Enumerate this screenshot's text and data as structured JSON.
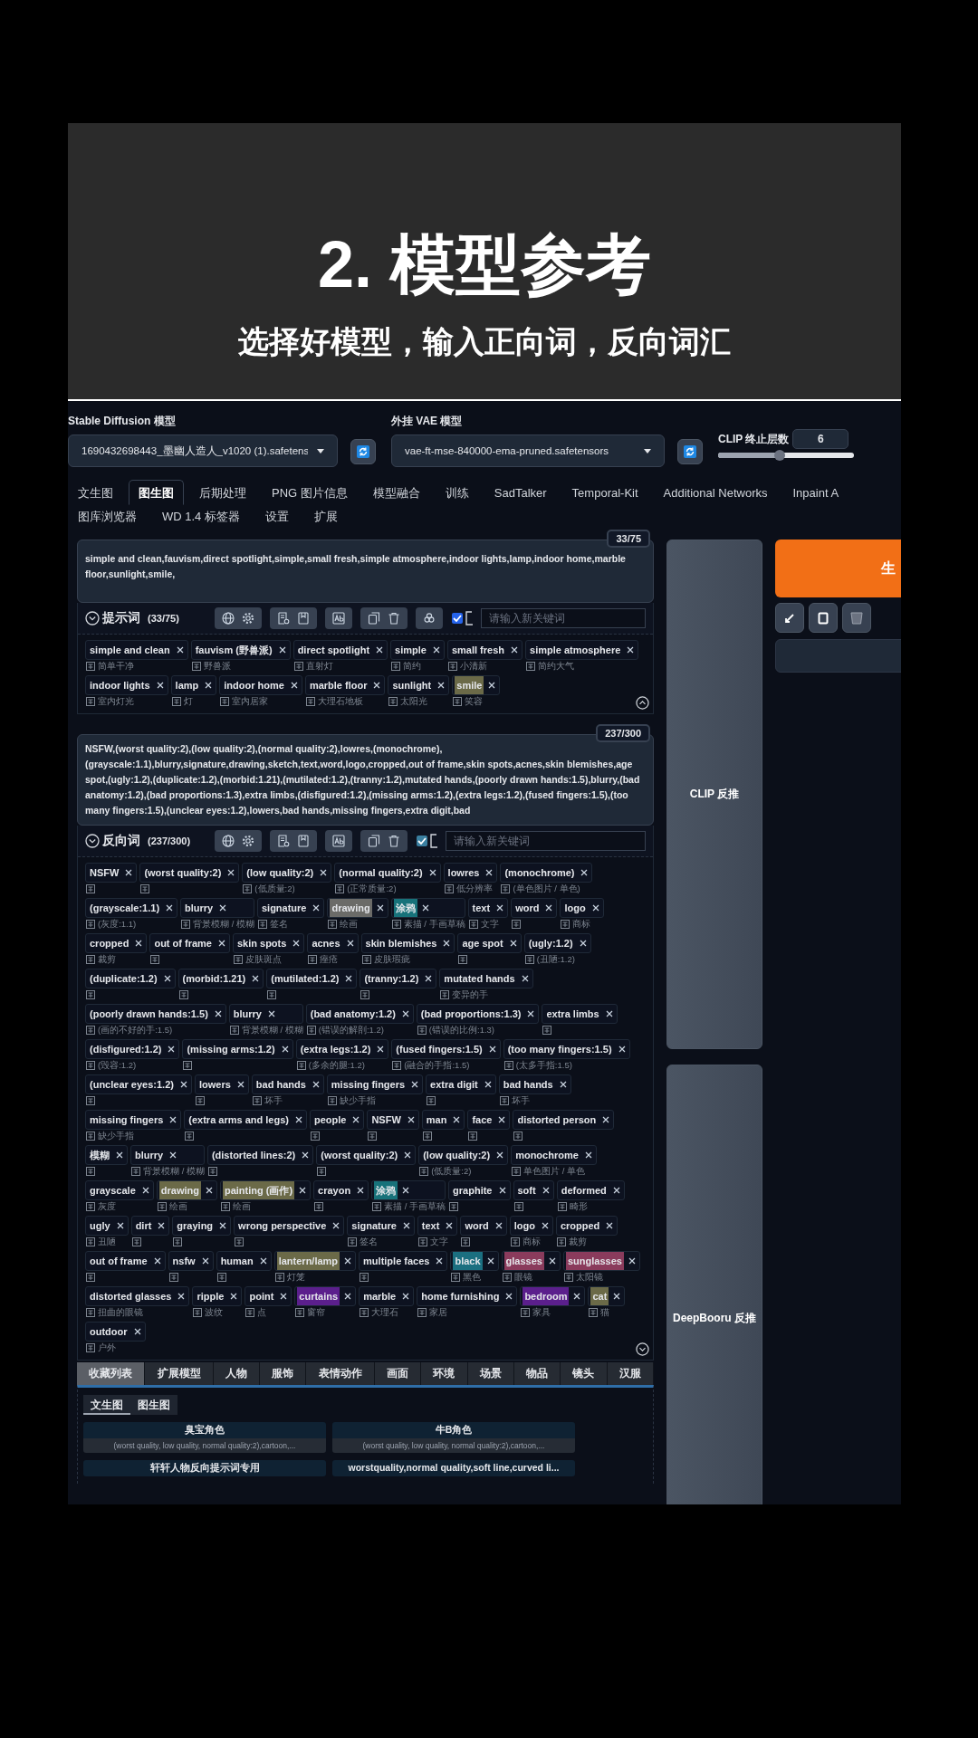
{
  "header": {
    "title": "2. 模型参考",
    "subtitle": "选择好模型，输入正向词，反向词汇"
  },
  "models": {
    "sd_label": "Stable Diffusion 模型",
    "sd_value": "1690432698443_墨幽人造人_v1020 (1).safetens",
    "vae_label": "外挂 VAE 模型",
    "vae_value": "vae-ft-mse-840000-ema-pruned.safetensors",
    "clip_label": "CLIP 终止层数",
    "clip_value": "6",
    "clip_slider": {
      "level": 0.45
    }
  },
  "tabs": [
    {
      "label": "文生图",
      "selected": false
    },
    {
      "label": "图生图",
      "selected": true
    },
    {
      "label": "后期处理",
      "selected": false
    },
    {
      "label": "PNG 图片信息",
      "selected": false
    },
    {
      "label": "模型融合",
      "selected": false
    },
    {
      "label": "训练",
      "selected": false
    },
    {
      "label": "SadTalker",
      "selected": false
    },
    {
      "label": "Temporal-Kit",
      "selected": false
    },
    {
      "label": "Additional Networks",
      "selected": false
    },
    {
      "label": "Inpaint A",
      "selected": false
    },
    {
      "label": "图库浏览器",
      "selected": false
    },
    {
      "label": "WD 1.4 标签器",
      "selected": false
    },
    {
      "label": "设置",
      "selected": false
    },
    {
      "label": "扩展",
      "selected": false
    }
  ],
  "positive": {
    "counter": "33/75",
    "text": "simple and clean,fauvism,direct spotlight,simple,small fresh,simple atmosphere,indoor lights,lamp,indoor home,marble floor,sunlight,smile,",
    "label": "提示词",
    "count": "(33/75)",
    "assistant_button": true,
    "checked": true,
    "placeholder": "请输入新关键词",
    "expanded": true,
    "tags": [
      {
        "text": "simple and clean",
        "sub": "简单干净"
      },
      {
        "text": "fauvism (野兽派)",
        "sub": "野兽派"
      },
      {
        "text": "direct spotlight",
        "sub": "直射灯"
      },
      {
        "text": "simple",
        "sub": "简约"
      },
      {
        "text": "small fresh",
        "sub": "小清新"
      },
      {
        "text": "simple atmosphere",
        "sub": "简约大气"
      },
      {
        "text": "indoor lights",
        "sub": "室内灯光"
      },
      {
        "text": "lamp",
        "sub": "灯"
      },
      {
        "text": "indoor home",
        "sub": "室内居家"
      },
      {
        "text": "marble floor",
        "sub": "大理石地板"
      },
      {
        "text": "sunlight",
        "sub": "太阳光"
      },
      {
        "text": "smile",
        "sub": "笑容",
        "color": "#6b6a48"
      }
    ]
  },
  "negative": {
    "counter": "237/300",
    "text": "NSFW,(worst quality:2),(low quality:2),(normal quality:2),lowres,(monochrome),(grayscale:1.1),blurry,signature,drawing,sketch,text,word,logo,cropped,out of frame,skin spots,acnes,skin blemishes,age spot,(ugly:1.2),(duplicate:1.2),(morbid:1.21),(mutilated:1.2),(tranny:1.2),mutated hands,(poorly drawn hands:1.5),blurry,(bad anatomy:1.2),(bad proportions:1.3),extra limbs,(disfigured:1.2),(missing arms:1.2),(extra legs:1.2),(fused fingers:1.5),(too many fingers:1.5),(unclear eyes:1.2),lowers,bad hands,missing fingers,extra digit,bad",
    "label": "反向词",
    "count": "(237/300)",
    "assistant_button": false,
    "checked": true,
    "placeholder": "请输入新关键词",
    "expanded": false,
    "tags": [
      {
        "text": "NSFW"
      },
      {
        "text": "(worst quality:2)"
      },
      {
        "text": "(low quality:2)",
        "sub": "(低质量:2)"
      },
      {
        "text": "(normal quality:2)",
        "sub": "(正常质量:2)"
      },
      {
        "text": "lowres",
        "sub": "低分辨率"
      },
      {
        "text": "(monochrome)",
        "sub": "(单色图片 / 单色)"
      },
      {
        "text": "(grayscale:1.1)",
        "sub": "(灰度:1.1)"
      },
      {
        "text": "blurry",
        "sub": "背景模糊 / 模糊"
      },
      {
        "text": "signature",
        "sub": "签名"
      },
      {
        "text": "drawing",
        "sub": "绘画",
        "color": "#6b6b68"
      },
      {
        "text": "涂鸦",
        "sub": "素描 / 手画草稿",
        "color": "#17727a"
      },
      {
        "text": "text",
        "sub": "文字"
      },
      {
        "text": "word"
      },
      {
        "text": "logo",
        "sub": "商标"
      },
      {
        "text": "cropped",
        "sub": "裁剪"
      },
      {
        "text": "out of frame"
      },
      {
        "text": "skin spots",
        "sub": "皮肤斑点"
      },
      {
        "text": "acnes",
        "sub": "痤疮"
      },
      {
        "text": "skin blemishes",
        "sub": "皮肤瑕疵"
      },
      {
        "text": "age spot"
      },
      {
        "text": "(ugly:1.2)",
        "sub": "(丑陋:1.2)"
      },
      {
        "text": "(duplicate:1.2)"
      },
      {
        "text": "(morbid:1.21)"
      },
      {
        "text": "(mutilated:1.2)"
      },
      {
        "text": "(tranny:1.2)"
      },
      {
        "text": "mutated hands",
        "sub": "变异的手"
      },
      {
        "text": "(poorly drawn hands:1.5)",
        "sub": "(画的不好的手:1.5)"
      },
      {
        "text": "blurry",
        "sub": "背景模糊 / 模糊"
      },
      {
        "text": "(bad anatomy:1.2)",
        "sub": "(错误的解剖:1.2)"
      },
      {
        "text": "(bad proportions:1.3)",
        "sub": "(错误的比例:1.3)"
      },
      {
        "text": "extra limbs"
      },
      {
        "text": "(disfigured:1.2)",
        "sub": "(毁容:1.2)"
      },
      {
        "text": "(missing arms:1.2)"
      },
      {
        "text": "(extra legs:1.2)",
        "sub": "(多余的腿:1.2)"
      },
      {
        "text": "(fused fingers:1.5)",
        "sub": "(融合的手指:1.5)"
      },
      {
        "text": "(too many fingers:1.5)",
        "sub": "(太多手指:1.5)"
      },
      {
        "text": "(unclear eyes:1.2)"
      },
      {
        "text": "lowers"
      },
      {
        "text": "bad hands",
        "sub": "坏手"
      },
      {
        "text": "missing fingers",
        "sub": "缺少手指"
      },
      {
        "text": "extra digit"
      },
      {
        "text": "bad hands",
        "sub": "坏手"
      },
      {
        "text": "missing fingers",
        "sub": "缺少手指"
      },
      {
        "text": "(extra arms and legs)"
      },
      {
        "text": "people"
      },
      {
        "text": "NSFW"
      },
      {
        "text": "man"
      },
      {
        "text": "face"
      },
      {
        "text": "distorted person"
      },
      {
        "text": "模糊"
      },
      {
        "text": "blurry",
        "sub": "背景模糊 / 模糊"
      },
      {
        "text": "(distorted lines:2)"
      },
      {
        "text": "(worst quality:2)"
      },
      {
        "text": "(low quality:2)",
        "sub": "(低质量:2)"
      },
      {
        "text": "monochrome",
        "sub": "单色图片 / 单色"
      },
      {
        "text": "grayscale",
        "sub": "灰度"
      },
      {
        "text": "drawing",
        "sub": "绘画",
        "color": "#6b6a48"
      },
      {
        "text": "painting (画作)",
        "sub": "绘画",
        "color": "#6b6a48"
      },
      {
        "text": "crayon"
      },
      {
        "text": "涂鸦",
        "sub": "素描 / 手画草稿",
        "color": "#17727a"
      },
      {
        "text": "graphite"
      },
      {
        "text": "soft"
      },
      {
        "text": "deformed",
        "sub": "畸形"
      },
      {
        "text": "ugly",
        "sub": "丑陋"
      },
      {
        "text": "dirt"
      },
      {
        "text": "graying"
      },
      {
        "text": "wrong perspective"
      },
      {
        "text": "signature",
        "sub": "签名"
      },
      {
        "text": "text",
        "sub": "文字"
      },
      {
        "text": "word"
      },
      {
        "text": "logo",
        "sub": "商标"
      },
      {
        "text": "cropped",
        "sub": "裁剪"
      },
      {
        "text": "out of frame"
      },
      {
        "text": "nsfw"
      },
      {
        "text": "human"
      },
      {
        "text": "lantern/lamp",
        "sub": "灯笼",
        "color": "#6b6a48"
      },
      {
        "text": "multiple faces"
      },
      {
        "text": "black",
        "sub": "黑色",
        "color": "#1b6f80"
      },
      {
        "text": "glasses",
        "sub": "眼镜",
        "color": "#8a3b5c"
      },
      {
        "text": "sunglasses",
        "sub": "太阳镜",
        "color": "#8a3b5c"
      },
      {
        "text": "distorted glasses",
        "sub": "扭曲的眼镜"
      },
      {
        "text": "ripple",
        "sub": "波纹"
      },
      {
        "text": "point",
        "sub": "点"
      },
      {
        "text": "curtains",
        "sub": "窗帘",
        "color": "#5b1f8c"
      },
      {
        "text": "marble",
        "sub": "大理石"
      },
      {
        "text": "home furnishing",
        "sub": "家居"
      },
      {
        "text": "bedroom",
        "sub": "家具",
        "color": "#5b1f8c"
      },
      {
        "text": "cat",
        "sub": "猫",
        "color": "#6b6a48"
      },
      {
        "text": "outdoor",
        "sub": "户外"
      }
    ]
  },
  "library": {
    "tabs": [
      {
        "label": "收藏列表",
        "selected": true
      },
      {
        "label": "扩展模型",
        "selected": false
      },
      {
        "label": "人物",
        "selected": false
      },
      {
        "label": "服饰",
        "selected": false
      },
      {
        "label": "表情动作",
        "selected": false
      },
      {
        "label": "画面",
        "selected": false
      },
      {
        "label": "环境",
        "selected": false
      },
      {
        "label": "场景",
        "selected": false
      },
      {
        "label": "物品",
        "selected": false
      },
      {
        "label": "镜头",
        "selected": false
      },
      {
        "label": "汉服",
        "selected": false
      }
    ],
    "subtabs": [
      {
        "label": "文生图",
        "selected": true
      },
      {
        "label": "图生图",
        "selected": false
      }
    ],
    "cards": [
      {
        "title": "臭宝角色",
        "preview": "(worst quality, low quality, normal quality:2),cartoon,..."
      },
      {
        "title": "牛B角色",
        "preview": "(worst quality, low quality, normal quality:2),cartoon,..."
      },
      {
        "title": "轩轩人物反向提示词专用"
      },
      {
        "title": "worstquality,normal quality,soft line,curved li..."
      }
    ]
  },
  "side": {
    "clip_button": "CLIP 反推",
    "deepbooru_button": "DeepBooru 反推",
    "generate_button": "生"
  }
}
